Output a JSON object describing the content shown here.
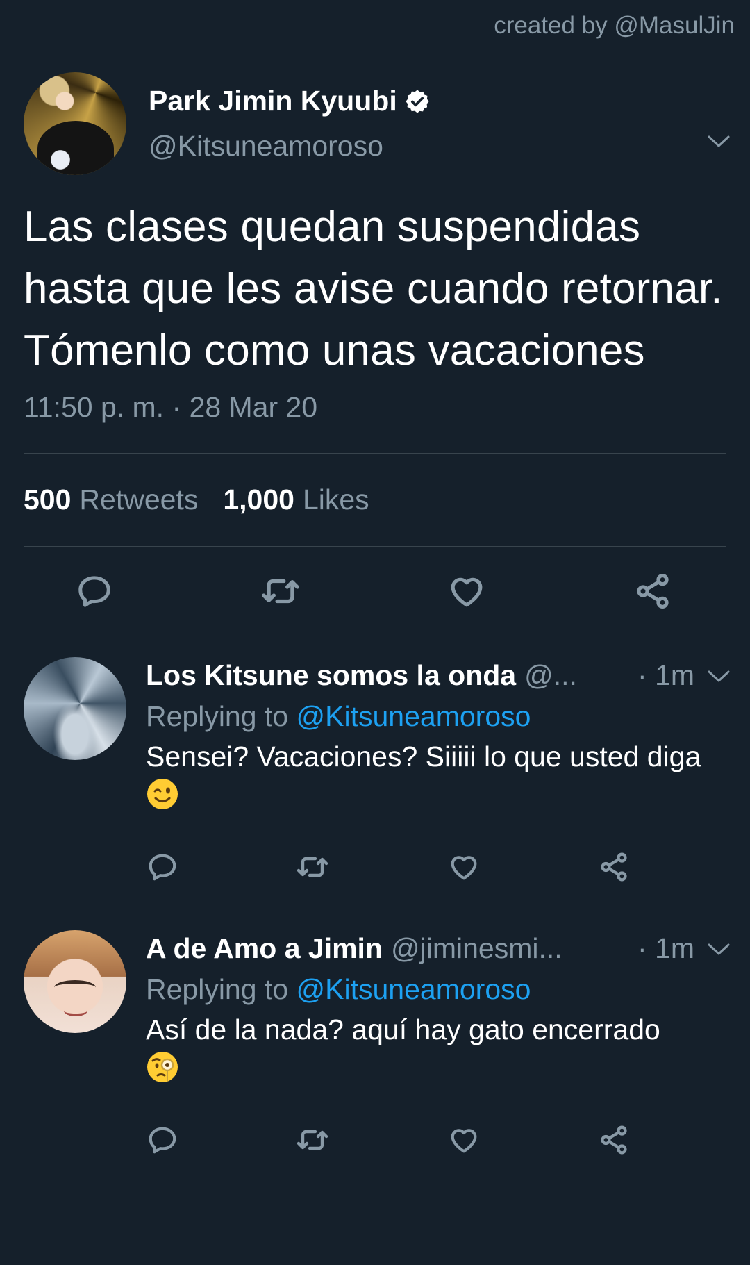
{
  "credit": "created by @MasulJin",
  "main_tweet": {
    "name": "Park Jimin Kyuubi",
    "handle": "@Kitsuneamoroso",
    "text": "Las clases quedan suspendidas hasta que les avise cuando retornar.\nTómenlo como unas vacaciones",
    "timestamp": "11:50 p. m. · 28 Mar 20",
    "retweets_count": "500",
    "retweets_label": "Retweets",
    "likes_count": "1,000",
    "likes_label": "Likes",
    "icons": [
      "reply-icon",
      "retweet-icon",
      "like-icon",
      "share-icon"
    ]
  },
  "replies": [
    {
      "name": "Los Kitsune somos la onda",
      "handle": "@...",
      "time": "· 1m",
      "replying_prefix": "Replying to",
      "replying_to": "@Kitsuneamoroso",
      "text": "Sensei? Vacaciones? Siiiii lo que usted diga",
      "emoji": "winking-face"
    },
    {
      "name": "A de Amo a Jimin",
      "handle": "@jiminesmi...",
      "time": "· 1m",
      "replying_prefix": "Replying to",
      "replying_to": "@Kitsuneamoroso",
      "text": "Así de la nada? aquí hay gato encerrado",
      "emoji": "face-with-monocle"
    }
  ],
  "colors": {
    "background": "#15202b",
    "divider": "#38444d",
    "secondary_text": "#8899a6",
    "mention": "#1da1f2"
  }
}
